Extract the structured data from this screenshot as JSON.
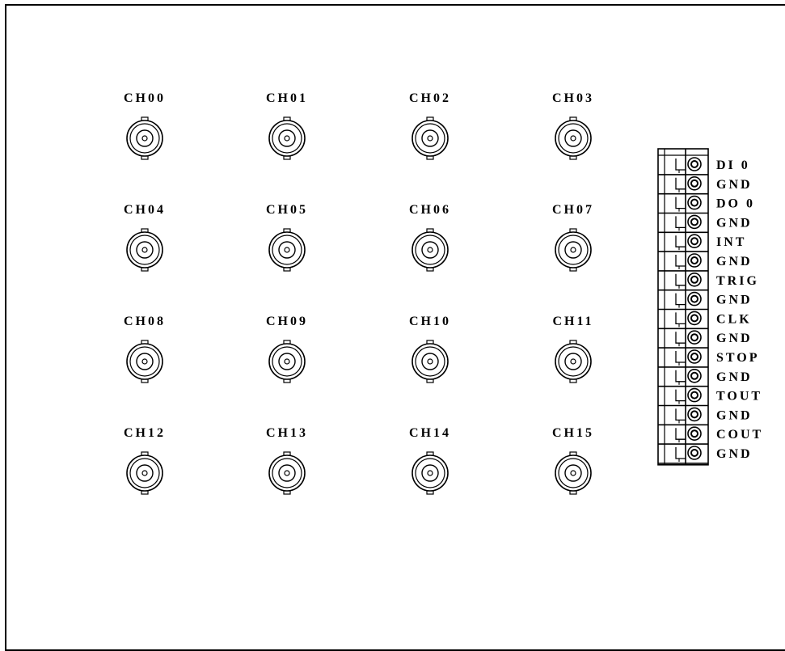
{
  "bnc_channels": [
    {
      "label": "CH00"
    },
    {
      "label": "CH01"
    },
    {
      "label": "CH02"
    },
    {
      "label": "CH03"
    },
    {
      "label": "CH04"
    },
    {
      "label": "CH05"
    },
    {
      "label": "CH06"
    },
    {
      "label": "CH07"
    },
    {
      "label": "CH08"
    },
    {
      "label": "CH09"
    },
    {
      "label": "CH10"
    },
    {
      "label": "CH11"
    },
    {
      "label": "CH12"
    },
    {
      "label": "CH13"
    },
    {
      "label": "CH14"
    },
    {
      "label": "CH15"
    }
  ],
  "terminal_block": {
    "pins": [
      {
        "label": "DI  0"
      },
      {
        "label": "GND"
      },
      {
        "label": "DO  0"
      },
      {
        "label": "GND"
      },
      {
        "label": "INT"
      },
      {
        "label": "GND"
      },
      {
        "label": "TRIG"
      },
      {
        "label": "GND"
      },
      {
        "label": "CLK"
      },
      {
        "label": "GND"
      },
      {
        "label": "STOP"
      },
      {
        "label": "GND"
      },
      {
        "label": "TOUT"
      },
      {
        "label": "GND"
      },
      {
        "label": "COUT"
      },
      {
        "label": "GND"
      }
    ]
  }
}
